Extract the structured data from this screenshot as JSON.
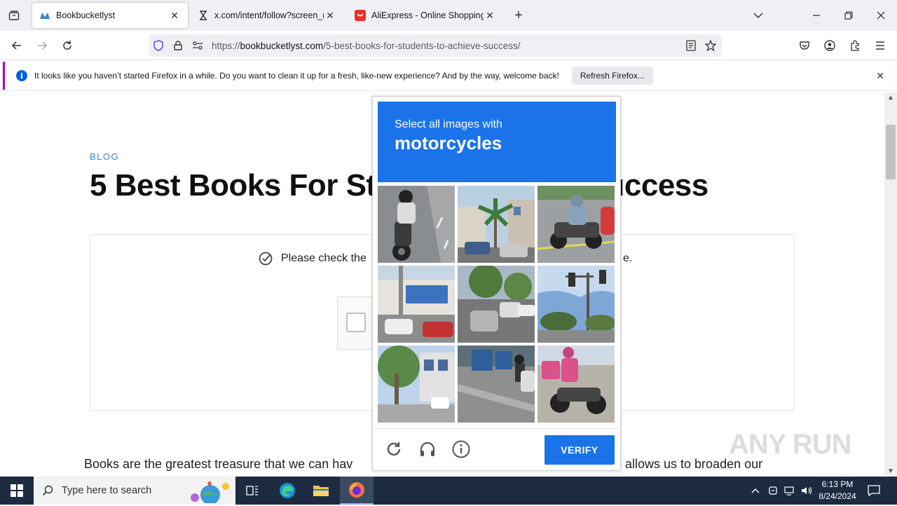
{
  "browser": {
    "tabs": [
      {
        "title": "Bookbucketlyst",
        "active": true
      },
      {
        "title": "x.com/intent/follow?screen_na",
        "active": false
      },
      {
        "title": "AliExpress - Online Shopping fo",
        "active": false
      }
    ],
    "url_prefix": "https://",
    "url_host": "bookbucketlyst.com",
    "url_path": "/5-best-books-for-students-to-achieve-success/"
  },
  "notification": {
    "message": "It looks like you haven’t started Firefox in a while. Do you want to clean it up for a fresh, like-new experience? And by the way, welcome back!",
    "button": "Refresh Firefox..."
  },
  "page": {
    "category": "BLOG",
    "headline_left": "5 Best Books For St",
    "headline_right": "ve Success",
    "check_message_left": "Please check the",
    "check_message_right": "e.",
    "body_left": "Books are the greatest treasure that we can hav",
    "body_right": "allows us to broaden our"
  },
  "captcha": {
    "prompt": "Select all images with",
    "target": "motorcycles",
    "verify_label": "VERIFY",
    "accent": "#1a73e8",
    "tiles": [
      {
        "name": "tile-1",
        "scene": "motorcycle"
      },
      {
        "name": "tile-2",
        "scene": "street-palm"
      },
      {
        "name": "tile-3",
        "scene": "motorcycle"
      },
      {
        "name": "tile-4",
        "scene": "street-cars"
      },
      {
        "name": "tile-5",
        "scene": "street-cars"
      },
      {
        "name": "tile-6",
        "scene": "traffic-light"
      },
      {
        "name": "tile-7",
        "scene": "street-trees"
      },
      {
        "name": "tile-8",
        "scene": "street-people"
      },
      {
        "name": "tile-9",
        "scene": "motorcycle"
      }
    ]
  },
  "watermark": "ANY RUN",
  "taskbar": {
    "search_placeholder": "Type here to search",
    "time": "6:13 PM",
    "date": "8/24/2024"
  }
}
